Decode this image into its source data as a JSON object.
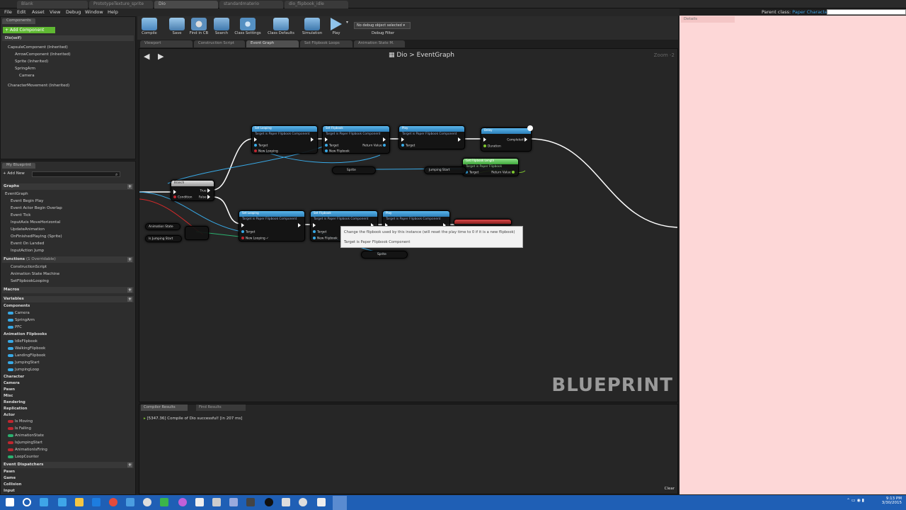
{
  "title_tabs": [
    "Blank",
    "PrototypeTexture_sprite",
    "Dio",
    "standardmaterio",
    "dio_flipbook_idle"
  ],
  "menu": [
    "File",
    "Edit",
    "Asset",
    "View",
    "Debug",
    "Window",
    "Help"
  ],
  "parent_class_label": "Parent class:",
  "parent_class_value": "Paper Character",
  "components": {
    "tab": "Components",
    "add_button": "+ Add Component",
    "root": "Dio(self)",
    "items": [
      "CapsuleComponent (Inherited)",
      "ArrowComponent (Inherited)",
      "Sprite (Inherited)",
      "SpringArm",
      "Camera",
      "CharacterMovement (Inherited)"
    ]
  },
  "my_blueprint": {
    "tab": "My Blueprint",
    "add_new": "+ Add New",
    "search_placeholder": "Search",
    "graphs_label": "Graphs",
    "graphs": [
      "EventGraph",
      "Event Begin Play",
      "Event Actor Begin Overlap",
      "Event Tick",
      "InputAxis MoveHorizontal",
      "UpdateAnimation",
      "OnFinishedPlaying (Sprite)",
      "Event On Landed",
      "InputAction Jump"
    ],
    "functions_label": "Functions",
    "functions_note": "(1 Overridable)",
    "functions": [
      "ConstructionScript",
      "Animation State Machine",
      "SetFlipbookLooping"
    ],
    "macros_label": "Macros",
    "variables_label": "Variables",
    "var_components_label": "Components",
    "var_components": [
      "Camera",
      "SpringArm",
      "PFC"
    ],
    "var_anim_label": "Animation Flipbooks",
    "var_anim": [
      "IdleFlipbook",
      "WalkingFlipbook",
      "LandingFlipbook",
      "JumpingStart",
      "JumpingLoop"
    ],
    "var_cats": [
      "Character",
      "Camera",
      "Pawn",
      "Misc",
      "Rendering",
      "Replication",
      "Actor"
    ],
    "var_actor": [
      "Is Moving",
      "Is Falling",
      "AnimationState",
      "IsJumpingStart",
      "AnimationIsFiring",
      "LoopCounter"
    ],
    "dispatchers_label": "Event Dispatchers",
    "dispatcher_cats": [
      "Pawn",
      "Game",
      "Collision",
      "Input"
    ]
  },
  "toolbar": [
    "Compile",
    "Save",
    "Find in CB",
    "Search",
    "Class Settings",
    "Class Defaults",
    "Simulation",
    "Play"
  ],
  "debug_select": "No debug object selected",
  "debug_filter": "Debug Filter",
  "graph_tabs": [
    "Viewport",
    "Construction Script",
    "Event Graph",
    "Set Flipbook Loops",
    "Animation State M."
  ],
  "breadcrumb": {
    "root": "Dio",
    "sep": ">",
    "leaf": "EventGraph"
  },
  "zoom": "Zoom -2",
  "watermark": "BLUEPRINT",
  "nodes": {
    "branch": {
      "title": "Branch",
      "condition": "Condition",
      "true": "True",
      "false": "False"
    },
    "set_looping_1": {
      "title": "Set Looping",
      "sub": "Target is Paper Flipbook Component",
      "target": "Target",
      "new_looping": "New Looping"
    },
    "set_flipbook_1": {
      "title": "Set Flipbook",
      "sub": "Target is Paper Flipbook Component",
      "target": "Target",
      "new_flipbook": "New Flipbook",
      "ret": "Return Value"
    },
    "play_1": {
      "title": "Play",
      "sub": "Target is Paper Flipbook Component",
      "target": "Target"
    },
    "delay": {
      "title": "Delay",
      "completed": "Completed",
      "duration": "Duration"
    },
    "green": {
      "title": "Get Flipbook Length",
      "sub": "Target is Paper Flipbook",
      "target": "Target",
      "ret": "Return Value"
    },
    "jumping_start": "Jumping Start",
    "sprite": "Sprite",
    "set_looping_2": {
      "title": "Set Looping",
      "sub": "Target is Paper Flipbook Component",
      "target": "Target",
      "new_looping": "New Looping"
    },
    "set_flipbook_2": {
      "title": "Set Flipbook",
      "sub": "Target is Paper Flipbook Component",
      "target": "Target",
      "new_flipbook": "New Flipbook"
    },
    "play_2": {
      "title": "Play",
      "sub": "Target is Paper Flipbook Component"
    },
    "anim_state": "Animation State",
    "is_jumping_start": "Is Jumping Start"
  },
  "tooltip": {
    "line1": "Change the flipbook used by this instance (will reset the play time to 0 if it is a new flipbook)",
    "line2": "Target is Paper Flipbook Component"
  },
  "output": {
    "tabs": [
      "Compiler Results",
      "Find Results"
    ],
    "message": "[5347.36] Compile of Dio successful! [in 207 ms]",
    "clear": "Clear"
  },
  "details_tab": "Details",
  "taskbar": {
    "time": "9:13 PM",
    "date": "3/30/2015"
  },
  "colors": {
    "accent_blue": "#38a9e6",
    "details_bg": "#fdd7d7",
    "taskbar": "#1f5fb5",
    "success_green": "#7ec82f"
  }
}
